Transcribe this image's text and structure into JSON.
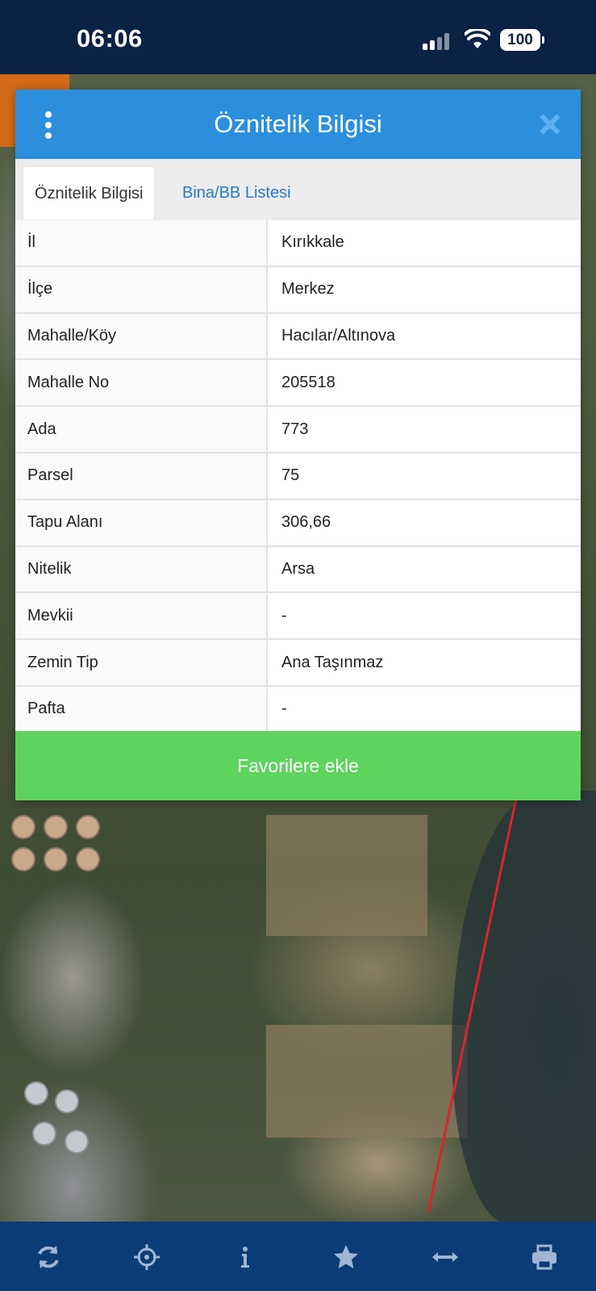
{
  "status_bar": {
    "time": "06:06",
    "battery": "100"
  },
  "modal": {
    "title": "Öznitelik Bilgisi",
    "tabs": [
      {
        "label": "Öznitelik Bilgisi",
        "active": true
      },
      {
        "label": "Bina/BB Listesi",
        "active": false
      }
    ],
    "rows": [
      {
        "label": "İl",
        "value": "Kırıkkale"
      },
      {
        "label": "İlçe",
        "value": "Merkez"
      },
      {
        "label": "Mahalle/Köy",
        "value": "Hacılar/Altınova"
      },
      {
        "label": "Mahalle No",
        "value": "205518"
      },
      {
        "label": "Ada",
        "value": "773"
      },
      {
        "label": "Parsel",
        "value": "75"
      },
      {
        "label": "Tapu Alanı",
        "value": "306,66"
      },
      {
        "label": "Nitelik",
        "value": "Arsa"
      },
      {
        "label": "Mevkii",
        "value": "-"
      },
      {
        "label": "Zemin Tip",
        "value": "Ana Taşınmaz"
      },
      {
        "label": "Pafta",
        "value": "-"
      }
    ],
    "favorite_button_label": "Favorilere ekle"
  },
  "toolbar": {
    "icons": [
      "refresh-icon",
      "locate-icon",
      "info-icon",
      "star-icon",
      "measure-icon",
      "print-icon"
    ]
  },
  "colors": {
    "header_blue": "#2b8fde",
    "favorite_green": "#5ed35e",
    "toolbar_blue": "#0b3c75",
    "status_bar": "#0b2244"
  }
}
